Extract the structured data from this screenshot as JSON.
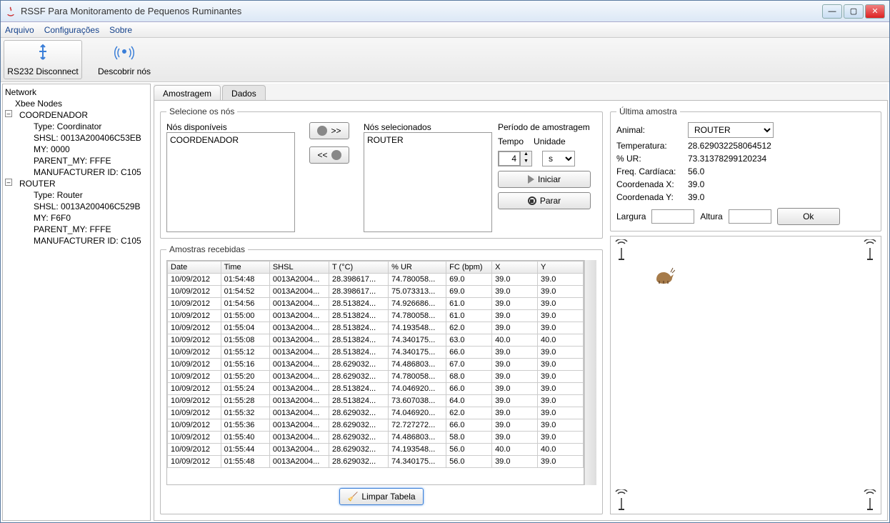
{
  "window": {
    "title": "RSSF Para Monitoramento de Pequenos Ruminantes"
  },
  "menu": {
    "file": "Arquivo",
    "config": "Configurações",
    "about": "Sobre"
  },
  "toolbar": {
    "disconnect": "RS232 Disconnect",
    "discover": "Descobrir nós"
  },
  "tree": {
    "root": "Network",
    "xbee": "Xbee Nodes",
    "coordinator": {
      "name": "COORDENADOR",
      "type": "Type: Coordinator",
      "shsl": "SHSL: 0013A200406C53EB",
      "my": "MY: 0000",
      "parent": "PARENT_MY: FFFE",
      "mfg": "MANUFACTURER ID: C105"
    },
    "router": {
      "name": "ROUTER",
      "type": "Type: Router",
      "shsl": "SHSL: 0013A200406C529B",
      "my": "MY: F6F0",
      "parent": "PARENT_MY: FFFE",
      "mfg": "MANUFACTURER ID: C105"
    }
  },
  "tabs": {
    "sampling": "Amostragem",
    "data": "Dados"
  },
  "select_nodes": {
    "legend": "Selecione os nós",
    "available_label": "Nós disponíveis",
    "selected_label": "Nós selecionados",
    "available": [
      "COORDENADOR"
    ],
    "selected": [
      "ROUTER"
    ],
    "move_right": ">>",
    "move_left": "<<"
  },
  "period": {
    "legend": "Período de amostragem",
    "tempo_label": "Tempo",
    "unidade_label": "Unidade",
    "tempo_value": "4",
    "unidade_value": "s",
    "start": "Iniciar",
    "stop": "Parar"
  },
  "samples": {
    "legend": "Amostras recebidas",
    "headers": {
      "date": "Date",
      "time": "Time",
      "shsl": "SHSL",
      "t": "T (°C)",
      "ur": "% UR",
      "fc": "FC (bpm)",
      "x": "X",
      "y": "Y"
    },
    "rows": [
      {
        "date": "10/09/2012",
        "time": "01:54:48",
        "shsl": "0013A2004...",
        "t": "28.398617...",
        "ur": "74.780058...",
        "fc": "69.0",
        "x": "39.0",
        "y": "39.0"
      },
      {
        "date": "10/09/2012",
        "time": "01:54:52",
        "shsl": "0013A2004...",
        "t": "28.398617...",
        "ur": "75.073313...",
        "fc": "69.0",
        "x": "39.0",
        "y": "39.0"
      },
      {
        "date": "10/09/2012",
        "time": "01:54:56",
        "shsl": "0013A2004...",
        "t": "28.513824...",
        "ur": "74.926686...",
        "fc": "61.0",
        "x": "39.0",
        "y": "39.0"
      },
      {
        "date": "10/09/2012",
        "time": "01:55:00",
        "shsl": "0013A2004...",
        "t": "28.513824...",
        "ur": "74.780058...",
        "fc": "61.0",
        "x": "39.0",
        "y": "39.0"
      },
      {
        "date": "10/09/2012",
        "time": "01:55:04",
        "shsl": "0013A2004...",
        "t": "28.513824...",
        "ur": "74.193548...",
        "fc": "62.0",
        "x": "39.0",
        "y": "39.0"
      },
      {
        "date": "10/09/2012",
        "time": "01:55:08",
        "shsl": "0013A2004...",
        "t": "28.513824...",
        "ur": "74.340175...",
        "fc": "63.0",
        "x": "40.0",
        "y": "40.0"
      },
      {
        "date": "10/09/2012",
        "time": "01:55:12",
        "shsl": "0013A2004...",
        "t": "28.513824...",
        "ur": "74.340175...",
        "fc": "66.0",
        "x": "39.0",
        "y": "39.0"
      },
      {
        "date": "10/09/2012",
        "time": "01:55:16",
        "shsl": "0013A2004...",
        "t": "28.629032...",
        "ur": "74.486803...",
        "fc": "67.0",
        "x": "39.0",
        "y": "39.0"
      },
      {
        "date": "10/09/2012",
        "time": "01:55:20",
        "shsl": "0013A2004...",
        "t": "28.629032...",
        "ur": "74.780058...",
        "fc": "68.0",
        "x": "39.0",
        "y": "39.0"
      },
      {
        "date": "10/09/2012",
        "time": "01:55:24",
        "shsl": "0013A2004...",
        "t": "28.513824...",
        "ur": "74.046920...",
        "fc": "66.0",
        "x": "39.0",
        "y": "39.0"
      },
      {
        "date": "10/09/2012",
        "time": "01:55:28",
        "shsl": "0013A2004...",
        "t": "28.513824...",
        "ur": "73.607038...",
        "fc": "64.0",
        "x": "39.0",
        "y": "39.0"
      },
      {
        "date": "10/09/2012",
        "time": "01:55:32",
        "shsl": "0013A2004...",
        "t": "28.629032...",
        "ur": "74.046920...",
        "fc": "62.0",
        "x": "39.0",
        "y": "39.0"
      },
      {
        "date": "10/09/2012",
        "time": "01:55:36",
        "shsl": "0013A2004...",
        "t": "28.629032...",
        "ur": "72.727272...",
        "fc": "66.0",
        "x": "39.0",
        "y": "39.0"
      },
      {
        "date": "10/09/2012",
        "time": "01:55:40",
        "shsl": "0013A2004...",
        "t": "28.629032...",
        "ur": "74.486803...",
        "fc": "58.0",
        "x": "39.0",
        "y": "39.0"
      },
      {
        "date": "10/09/2012",
        "time": "01:55:44",
        "shsl": "0013A2004...",
        "t": "28.629032...",
        "ur": "74.193548...",
        "fc": "56.0",
        "x": "40.0",
        "y": "40.0"
      },
      {
        "date": "10/09/2012",
        "time": "01:55:48",
        "shsl": "0013A2004...",
        "t": "28.629032...",
        "ur": "74.340175...",
        "fc": "56.0",
        "x": "39.0",
        "y": "39.0"
      }
    ],
    "clear_button": "Limpar Tabela"
  },
  "last_sample": {
    "legend": "Última amostra",
    "animal_label": "Animal:",
    "animal_value": "ROUTER",
    "temp_label": "Temperatura:",
    "temp_value": "28.629032258064512",
    "ur_label": "% UR:",
    "ur_value": "73.31378299120234",
    "fc_label": "Freq. Cardíaca:",
    "fc_value": "56.0",
    "x_label": "Coordenada X:",
    "x_value": "39.0",
    "y_label": "Coordenada Y:",
    "y_value": "39.0",
    "largura_label": "Largura",
    "altura_label": "Altura",
    "ok": "Ok"
  }
}
